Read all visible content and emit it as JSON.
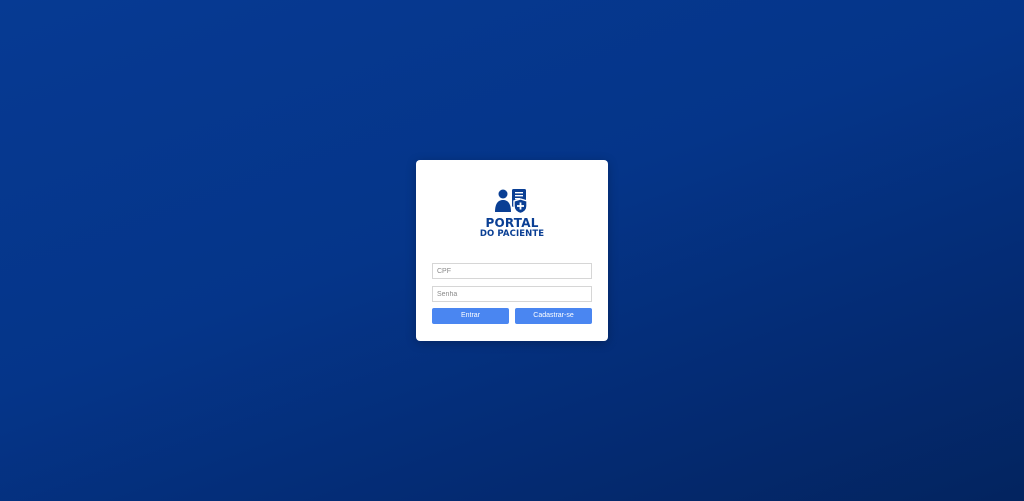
{
  "login": {
    "logo": {
      "icon": "patient-document-shield-icon",
      "title": "PORTAL",
      "subtitle": "DO PACIENTE"
    },
    "cpf_field": {
      "placeholder": "CPF",
      "value": ""
    },
    "password_field": {
      "placeholder": "Senha",
      "value": ""
    },
    "login_button_label": "Entrar",
    "register_button_label": "Cadastrar-se"
  },
  "colors": {
    "background": "#053589",
    "brand": "#0a3f94",
    "button": "#4a86f1",
    "card": "#ffffff"
  }
}
